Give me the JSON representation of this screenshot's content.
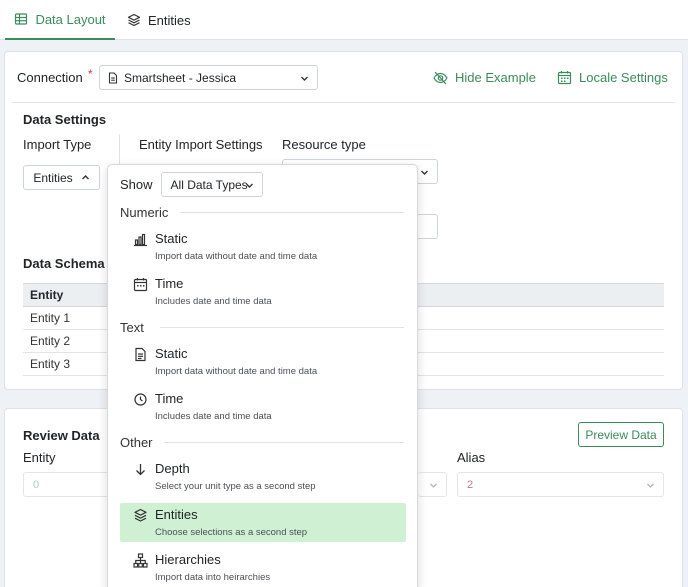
{
  "tabs": [
    {
      "label": "Data Layout",
      "icon": "table-icon",
      "active": true
    },
    {
      "label": "Entities",
      "icon": "layers-icon",
      "active": false
    }
  ],
  "connection": {
    "label": "Connection",
    "required_mark": "*",
    "value": "Smartsheet - Jessica",
    "icon": "file-icon"
  },
  "header_actions": {
    "hide_example": "Hide Example",
    "locale_settings": "Locale Settings"
  },
  "data_settings": {
    "title": "Data Settings",
    "import_type_label": "Import Type",
    "import_type_value": "Entities",
    "entity_import_settings_label": "Entity Import Settings",
    "resource_type_label": "Resource type"
  },
  "schema": {
    "title": "Data Schema E",
    "column": "Entity",
    "rows": [
      "Entity 1",
      "Entity 2",
      "Entity 3"
    ]
  },
  "review": {
    "title": "Review Data",
    "entity_label": "Entity",
    "alias_label": "Alias",
    "entity_value": "0",
    "alias_value": "2",
    "preview_button": "Preview Data"
  },
  "dropdown": {
    "show_label": "Show",
    "show_value": "All Data Types",
    "groups": [
      {
        "name": "Numeric",
        "options": [
          {
            "title": "Static",
            "desc": "Import data without date and time data",
            "icon": "bar-chart-icon"
          },
          {
            "title": "Time",
            "desc": "Includes date and time data",
            "icon": "calendar-icon"
          }
        ]
      },
      {
        "name": "Text",
        "options": [
          {
            "title": "Static",
            "desc": "Import data without date and time data",
            "icon": "document-icon"
          },
          {
            "title": "Time",
            "desc": "Includes date and time data",
            "icon": "clock-icon"
          }
        ]
      },
      {
        "name": "Other",
        "options": [
          {
            "title": "Depth",
            "desc": "Select your unit type as a second step",
            "icon": "arrow-down-icon"
          },
          {
            "title": "Entities",
            "desc": "Choose selections as a second step",
            "icon": "layers-icon",
            "selected": true
          },
          {
            "title": "Hierarchies",
            "desc": "Import data into heirarchies",
            "icon": "hierarchy-icon"
          }
        ]
      }
    ]
  },
  "colors": {
    "accent": "#3b8c5a",
    "selected_bg": "#d0f0d3"
  }
}
